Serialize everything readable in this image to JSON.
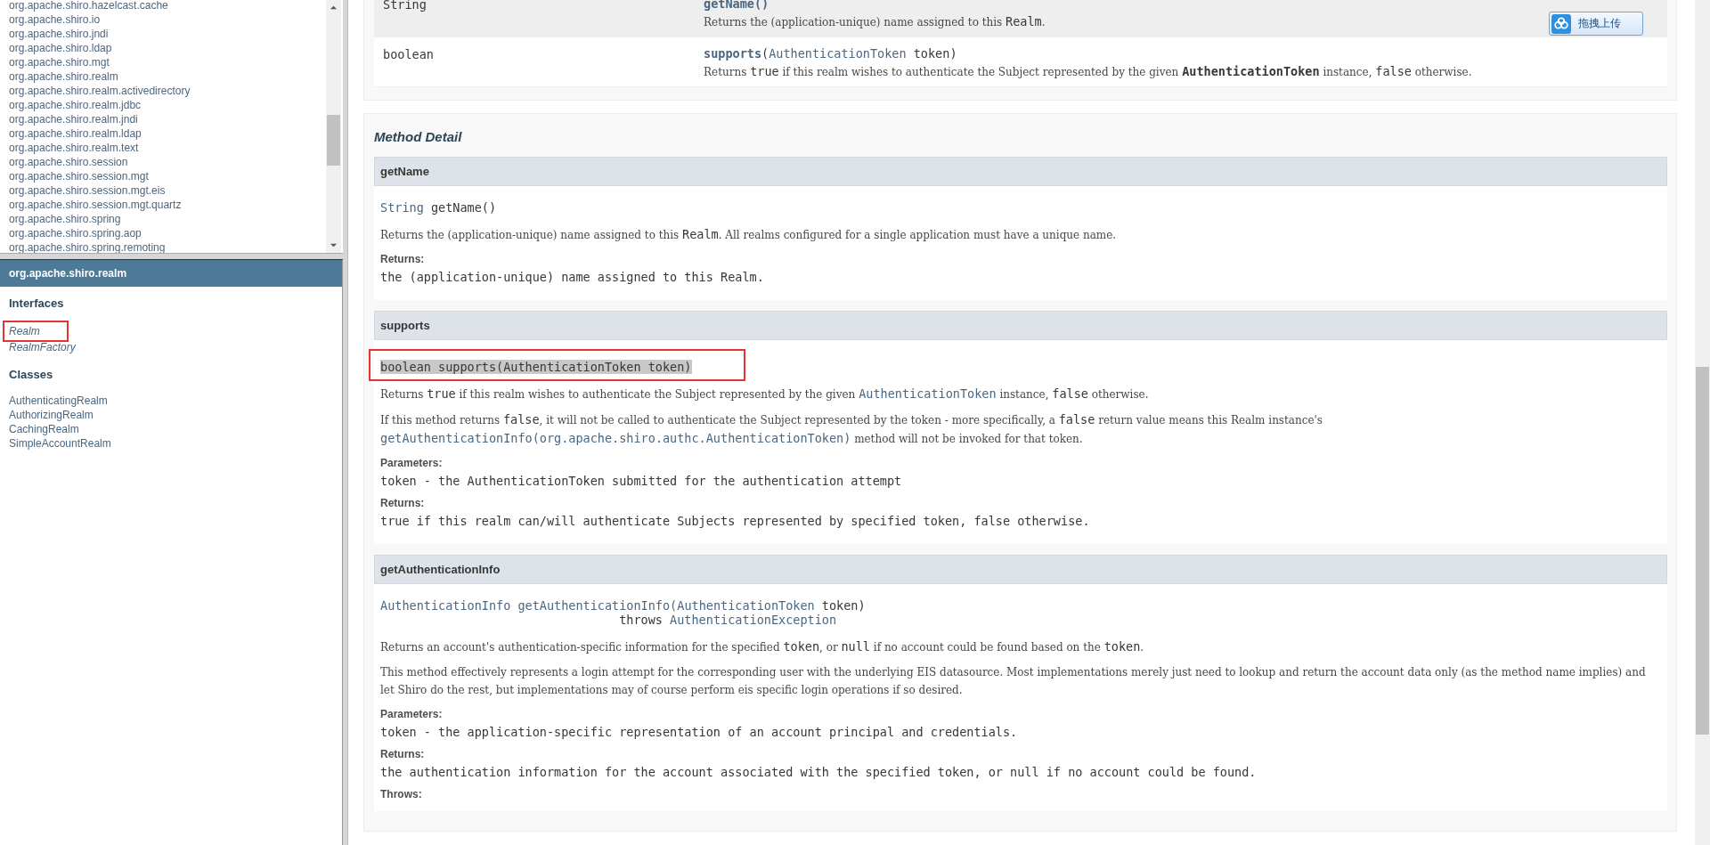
{
  "package_list": {
    "items": [
      "org.apache.shiro.hazelcast.cache",
      "org.apache.shiro.io",
      "org.apache.shiro.jndi",
      "org.apache.shiro.ldap",
      "org.apache.shiro.mgt",
      "org.apache.shiro.realm",
      "org.apache.shiro.realm.activedirectory",
      "org.apache.shiro.realm.jdbc",
      "org.apache.shiro.realm.jndi",
      "org.apache.shiro.realm.ldap",
      "org.apache.shiro.realm.text",
      "org.apache.shiro.session",
      "org.apache.shiro.session.mgt",
      "org.apache.shiro.session.mgt.eis",
      "org.apache.shiro.session.mgt.quartz",
      "org.apache.shiro.spring",
      "org.apache.shiro.spring.aop",
      "org.apache.shiro.spring.remoting"
    ]
  },
  "package_frame": {
    "title": "org.apache.shiro.realm",
    "sections": [
      {
        "heading": "Interfaces",
        "items": [
          {
            "label": "Realm",
            "kind": "interface",
            "highlighted": true
          },
          {
            "label": "RealmFactory",
            "kind": "interface",
            "highlighted": false
          }
        ]
      },
      {
        "heading": "Classes",
        "items": [
          {
            "label": "AuthenticatingRealm",
            "kind": "class",
            "highlighted": false
          },
          {
            "label": "AuthorizingRealm",
            "kind": "class",
            "highlighted": false
          },
          {
            "label": "CachingRealm",
            "kind": "class",
            "highlighted": false
          },
          {
            "label": "SimpleAccountRealm",
            "kind": "class",
            "highlighted": false
          }
        ]
      }
    ]
  },
  "upload_button": {
    "label": "拖拽上传"
  },
  "method_summary": {
    "rows": [
      {
        "type": "String",
        "signature": [
          {
            "kind": "code-bold",
            "text": "getName"
          },
          {
            "kind": "code-bold",
            "text": "()"
          }
        ],
        "description": [
          {
            "kind": "text",
            "text": "Returns the (application-unique) name assigned to this "
          },
          {
            "kind": "code",
            "text": "Realm"
          },
          {
            "kind": "text",
            "text": "."
          }
        ]
      },
      {
        "type": "boolean",
        "signature": [
          {
            "kind": "code-bold",
            "text": "supports"
          },
          {
            "kind": "code",
            "text": "("
          },
          {
            "kind": "code-link",
            "text": "AuthenticationToken"
          },
          {
            "kind": "code",
            "text": " token)"
          }
        ],
        "description": [
          {
            "kind": "text",
            "text": "Returns "
          },
          {
            "kind": "code",
            "text": "true"
          },
          {
            "kind": "text",
            "text": " if this realm wishes to authenticate the Subject represented by the given "
          },
          {
            "kind": "code-bold",
            "text": "AuthenticationToken"
          },
          {
            "kind": "text",
            "text": " instance, "
          },
          {
            "kind": "code",
            "text": "false"
          },
          {
            "kind": "text",
            "text": " otherwise."
          }
        ]
      }
    ]
  },
  "method_detail": {
    "heading": "Method Detail",
    "methods": [
      {
        "name": "getName",
        "highlighted": false,
        "selected": false,
        "signature": [
          {
            "kind": "code-link",
            "text": "String"
          },
          {
            "kind": "code",
            "text": " getName()"
          }
        ],
        "blocks": [
          {
            "kind": "paragraph",
            "segments": [
              {
                "kind": "text",
                "text": "Returns the (application-unique) name assigned to this "
              },
              {
                "kind": "code",
                "text": "Realm"
              },
              {
                "kind": "text",
                "text": ". All realms configured for a single application must have a unique name."
              }
            ]
          },
          {
            "kind": "label",
            "text": "Returns:"
          },
          {
            "kind": "code",
            "text": "the (application-unique) name assigned to this Realm."
          }
        ]
      },
      {
        "name": "supports",
        "highlighted": true,
        "selected": true,
        "signature": [
          {
            "kind": "code",
            "text": "boolean supports(AuthenticationToken token)"
          }
        ],
        "blocks": [
          {
            "kind": "paragraph",
            "segments": [
              {
                "kind": "text",
                "text": "Returns "
              },
              {
                "kind": "code",
                "text": "true"
              },
              {
                "kind": "text",
                "text": " if this realm wishes to authenticate the Subject represented by the given "
              },
              {
                "kind": "code-link",
                "text": "AuthenticationToken"
              },
              {
                "kind": "text",
                "text": " instance, "
              },
              {
                "kind": "code",
                "text": "false"
              },
              {
                "kind": "text",
                "text": " otherwise."
              }
            ]
          },
          {
            "kind": "paragraph",
            "segments": [
              {
                "kind": "text",
                "text": "If this method returns "
              },
              {
                "kind": "code",
                "text": "false"
              },
              {
                "kind": "text",
                "text": ", it will not be called to authenticate the Subject represented by the token - more specifically, a "
              },
              {
                "kind": "code",
                "text": "false"
              },
              {
                "kind": "text",
                "text": " return value means this Realm instance's "
              },
              {
                "kind": "code-link",
                "text": "getAuthenticationInfo(org.apache.shiro.authc.AuthenticationToken)"
              },
              {
                "kind": "text",
                "text": " method will not be invoked for that token."
              }
            ]
          },
          {
            "kind": "label",
            "text": "Parameters:"
          },
          {
            "kind": "code",
            "text": "token - the AuthenticationToken submitted for the authentication attempt"
          },
          {
            "kind": "label",
            "text": "Returns:"
          },
          {
            "kind": "code",
            "text": "true if this realm can/will authenticate Subjects represented by specified token, false otherwise."
          }
        ]
      },
      {
        "name": "getAuthenticationInfo",
        "highlighted": false,
        "selected": false,
        "signature": [
          {
            "kind": "code-link",
            "text": "AuthenticationInfo"
          },
          {
            "kind": "code-link",
            "text": " getAuthenticationInfo("
          },
          {
            "kind": "code-link",
            "text": "AuthenticationToken"
          },
          {
            "kind": "code",
            "text": " token)\n                                 throws "
          },
          {
            "kind": "code-link",
            "text": "AuthenticationException"
          }
        ],
        "blocks": [
          {
            "kind": "paragraph",
            "segments": [
              {
                "kind": "text",
                "text": "Returns an account's authentication-specific information for the specified "
              },
              {
                "kind": "code",
                "text": "token"
              },
              {
                "kind": "text",
                "text": ", or "
              },
              {
                "kind": "code",
                "text": "null"
              },
              {
                "kind": "text",
                "text": " if no account could be found based on the "
              },
              {
                "kind": "code",
                "text": "token"
              },
              {
                "kind": "text",
                "text": "."
              }
            ]
          },
          {
            "kind": "paragraph",
            "segments": [
              {
                "kind": "text",
                "text": "This method effectively represents a login attempt for the corresponding user with the underlying EIS datasource. Most implementations merely just need to lookup and return the account data only (as the method name implies) and let Shiro do the rest, but implementations may of course perform eis specific login operations if so desired."
              }
            ]
          },
          {
            "kind": "label",
            "text": "Parameters:"
          },
          {
            "kind": "code",
            "text": "token - the application-specific representation of an account principal and credentials."
          },
          {
            "kind": "label",
            "text": "Returns:"
          },
          {
            "kind": "code",
            "text": "the authentication information for the account associated with the specified token, or null if no account could be found."
          },
          {
            "kind": "label",
            "text": "Throws:"
          }
        ]
      }
    ]
  }
}
